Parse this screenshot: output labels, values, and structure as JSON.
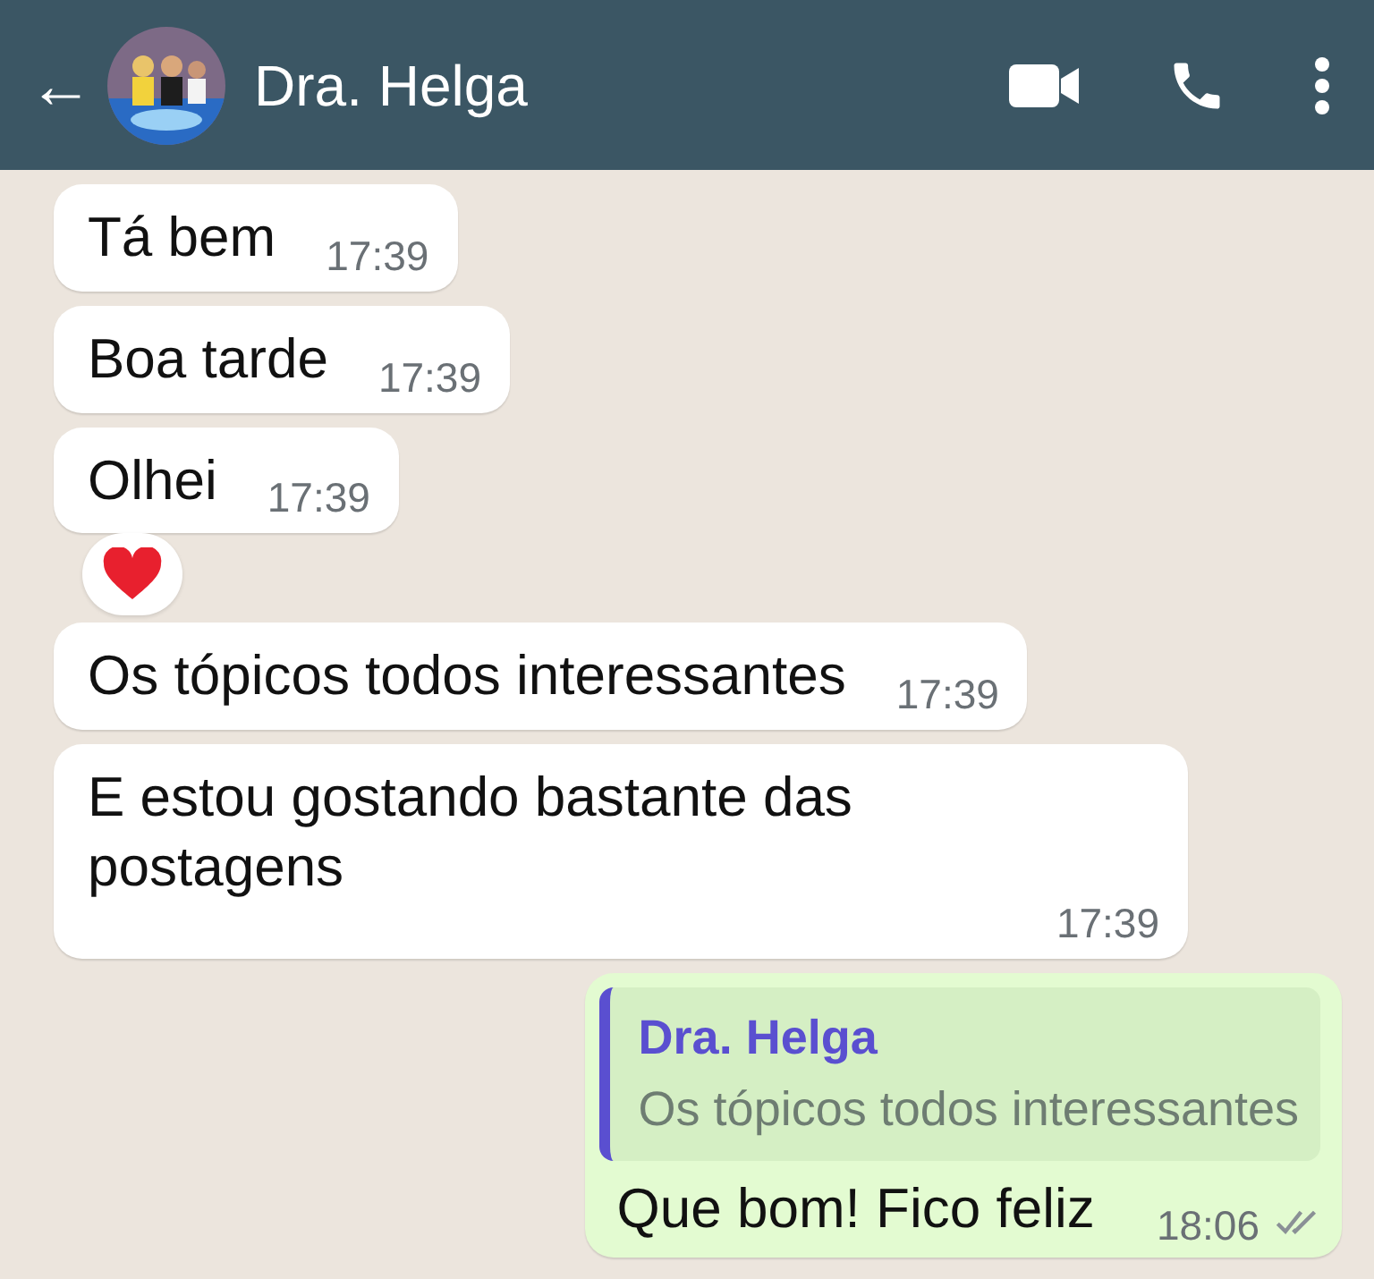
{
  "header": {
    "back": "←",
    "contact_name": "Dra. Helga"
  },
  "messages": [
    {
      "kind": "incoming",
      "text": "Tá bem",
      "time": "17:39"
    },
    {
      "kind": "incoming",
      "text": "Boa tarde",
      "time": "17:39"
    },
    {
      "kind": "incoming",
      "text": "Olhei",
      "time": "17:39",
      "heart_reaction": true
    },
    {
      "kind": "incoming",
      "text": "Os tópicos todos interessantes",
      "time": "17:39"
    },
    {
      "kind": "incoming",
      "text": "E estou gostando bastante das postagens",
      "time": "17:39"
    },
    {
      "kind": "outgoing",
      "text": "Que bom! Fico feliz",
      "time": "18:06",
      "read": false,
      "quote": {
        "author": "Dra. Helga",
        "text": "Os tópicos todos interessantes"
      }
    }
  ]
}
